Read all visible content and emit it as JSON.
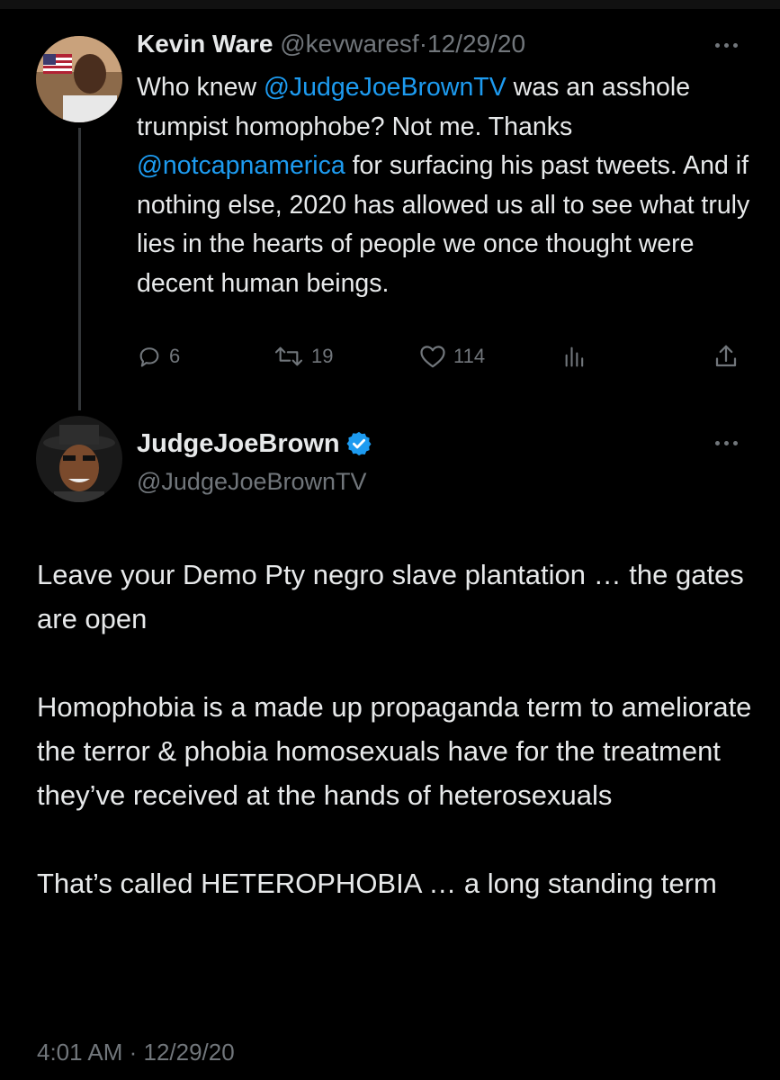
{
  "reply_parent": {
    "display_name": "Kevin Ware",
    "handle": "@kevwaresf",
    "separator": "·",
    "date": "12/29/20",
    "text_1": "Who knew ",
    "mention_1": "@JudgeJoeBrownTV",
    "text_2": " was an asshole trumpist homophobe? Not me. Thanks ",
    "mention_2": "@notcapnamerica",
    "text_3": " for surfacing his past tweets. And if nothing else, 2020 has allowed us all to see what truly lies in the hearts of people we once thought were decent human beings.",
    "replies": "6",
    "retweets": "19",
    "likes": "114"
  },
  "main_tweet": {
    "display_name": "JudgeJoeBrown",
    "verified": true,
    "handle": "@JudgeJoeBrownTV",
    "paragraph_1": "Leave your Demo Pty negro slave plantation … the gates are open",
    "paragraph_2": "Homophobia is a made up propaganda term to ameliorate the terror & phobia homosexuals have for the treatment they’ve received at the hands of heterosexuals",
    "paragraph_3": "That’s called HETEROPHOBIA … a long standing term",
    "timestamp": "4:01 AM · 12/29/20"
  },
  "icons": {
    "reply": "reply-icon",
    "retweet": "retweet-icon",
    "like": "heart-icon",
    "views": "views-icon",
    "share": "share-icon",
    "more": "more-options-icon",
    "verified": "verified-badge-icon"
  },
  "colors": {
    "background": "#000000",
    "text": "#e7e9ea",
    "muted": "#71767b",
    "link": "#1d9bf0",
    "verified": "#1d9bf0"
  }
}
